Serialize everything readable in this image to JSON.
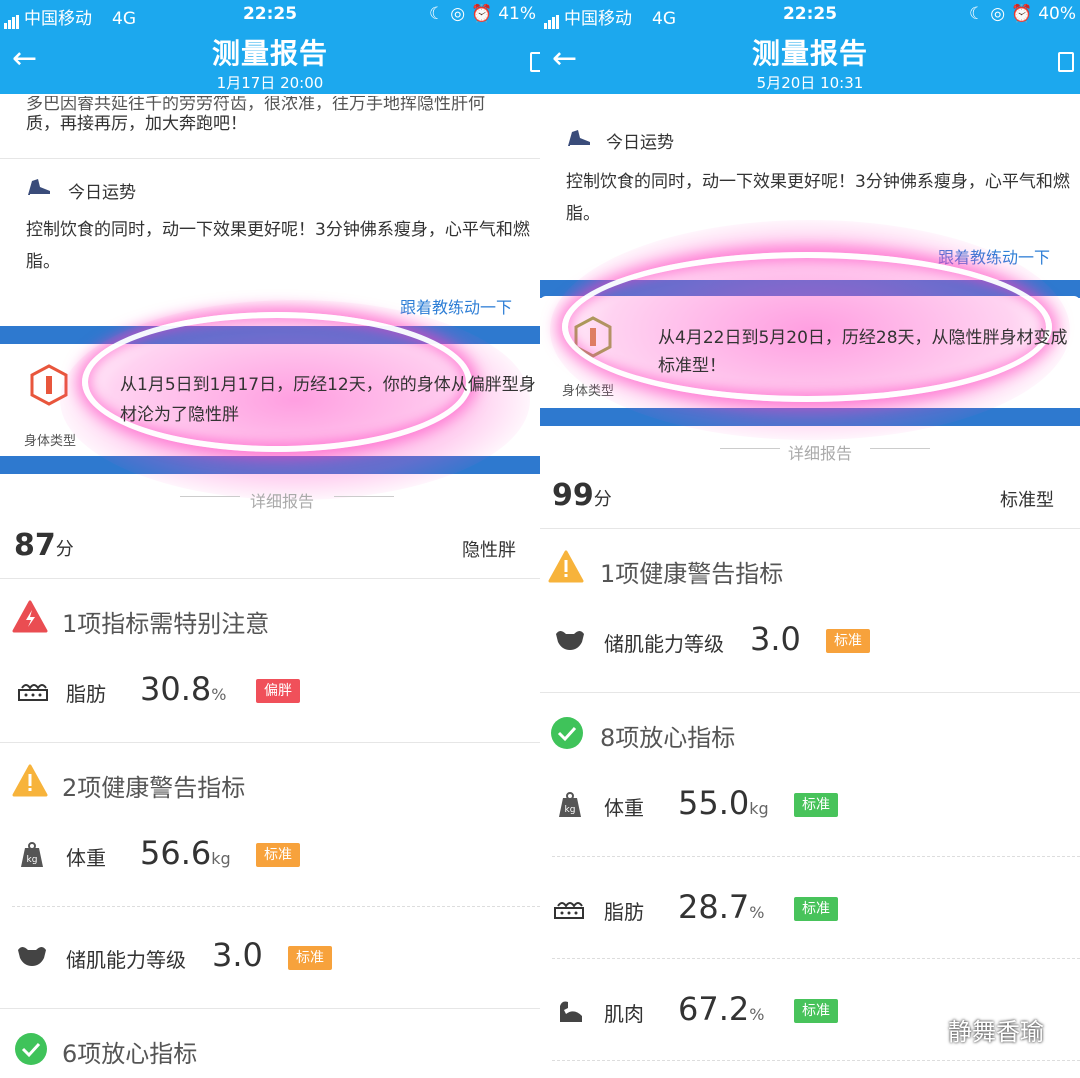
{
  "left": {
    "status": {
      "carrier": "中国移动",
      "network": "4G",
      "time": "22:25",
      "battery": "41%"
    },
    "nav": {
      "title": "测量报告",
      "subtitle": "1月17日 20:00"
    },
    "intro_text_top": "多巴因睿共延往千的劳劳符齿，很浓准，往万手地挥隐性肝何",
    "intro_text": "质，再接再厉，加大奔跑吧！",
    "luck": {
      "heading": "今日运势",
      "body": "控制饮食的同时，动一下效果更好呢！3分钟佛系瘦身，心平气和燃脂。",
      "link": "跟着教练动一下"
    },
    "body_type_card": {
      "label": "身体类型",
      "text": "从1月5日到1月17日，历经12天，你的身体从偏胖型身材沦为了隐性胖"
    },
    "detail_label": "详细报告",
    "score": "87",
    "score_unit": "分",
    "body_type": "隐性胖",
    "section_alert": {
      "title": "1项指标需特别注意"
    },
    "fat": {
      "label": "脂肪",
      "value": "30.8",
      "unit": "%",
      "tag": "偏胖"
    },
    "section_warn": {
      "title": "2项健康警告指标"
    },
    "weight": {
      "label": "体重",
      "value": "56.6",
      "unit": "kg",
      "tag": "标准"
    },
    "muscle_storage": {
      "label": "储肌能力等级",
      "value": "3.0",
      "tag": "标准"
    },
    "section_ok": {
      "title": "6项放心指标"
    }
  },
  "right": {
    "status": {
      "carrier": "中国移动",
      "network": "4G",
      "time": "22:25",
      "battery": "40%"
    },
    "nav": {
      "title": "测量报告",
      "subtitle": "5月20日 10:31"
    },
    "luck": {
      "heading": "今日运势",
      "body": "控制饮食的同时，动一下效果更好呢！3分钟佛系瘦身，心平气和燃脂。",
      "link": "跟着教练动一下"
    },
    "body_type_card": {
      "label": "身体类型",
      "text": "从4月22日到5月20日，历经28天，从隐性胖身材变成标准型！"
    },
    "detail_label": "详细报告",
    "score": "99",
    "score_unit": "分",
    "body_type": "标准型",
    "section_warn": {
      "title": "1项健康警告指标"
    },
    "muscle_storage": {
      "label": "储肌能力等级",
      "value": "3.0",
      "tag": "标准"
    },
    "section_ok": {
      "title": "8项放心指标"
    },
    "weight": {
      "label": "体重",
      "value": "55.0",
      "unit": "kg",
      "tag": "标准"
    },
    "fat": {
      "label": "脂肪",
      "value": "28.7",
      "unit": "%",
      "tag": "标准"
    },
    "muscle": {
      "label": "肌肉",
      "value": "67.2",
      "unit": "%",
      "tag": "标准"
    }
  },
  "watermark": "静舞香瑜",
  "colors": {
    "header": "#1ca8ee",
    "band": "#2e79cf",
    "red": "#f0505a",
    "orange": "#f7a23c",
    "green": "#48c35b",
    "link": "#2f7fd6"
  },
  "icons": [
    "back-arrow-icon",
    "share-icon",
    "luck-shoe-icon",
    "body-type-hex-icon",
    "alert-red-icon",
    "warning-yellow-icon",
    "check-green-icon",
    "fat-icon",
    "scale-kg-icon",
    "muscle-storage-icon",
    "muscle-arm-icon",
    "wechat-icon"
  ]
}
